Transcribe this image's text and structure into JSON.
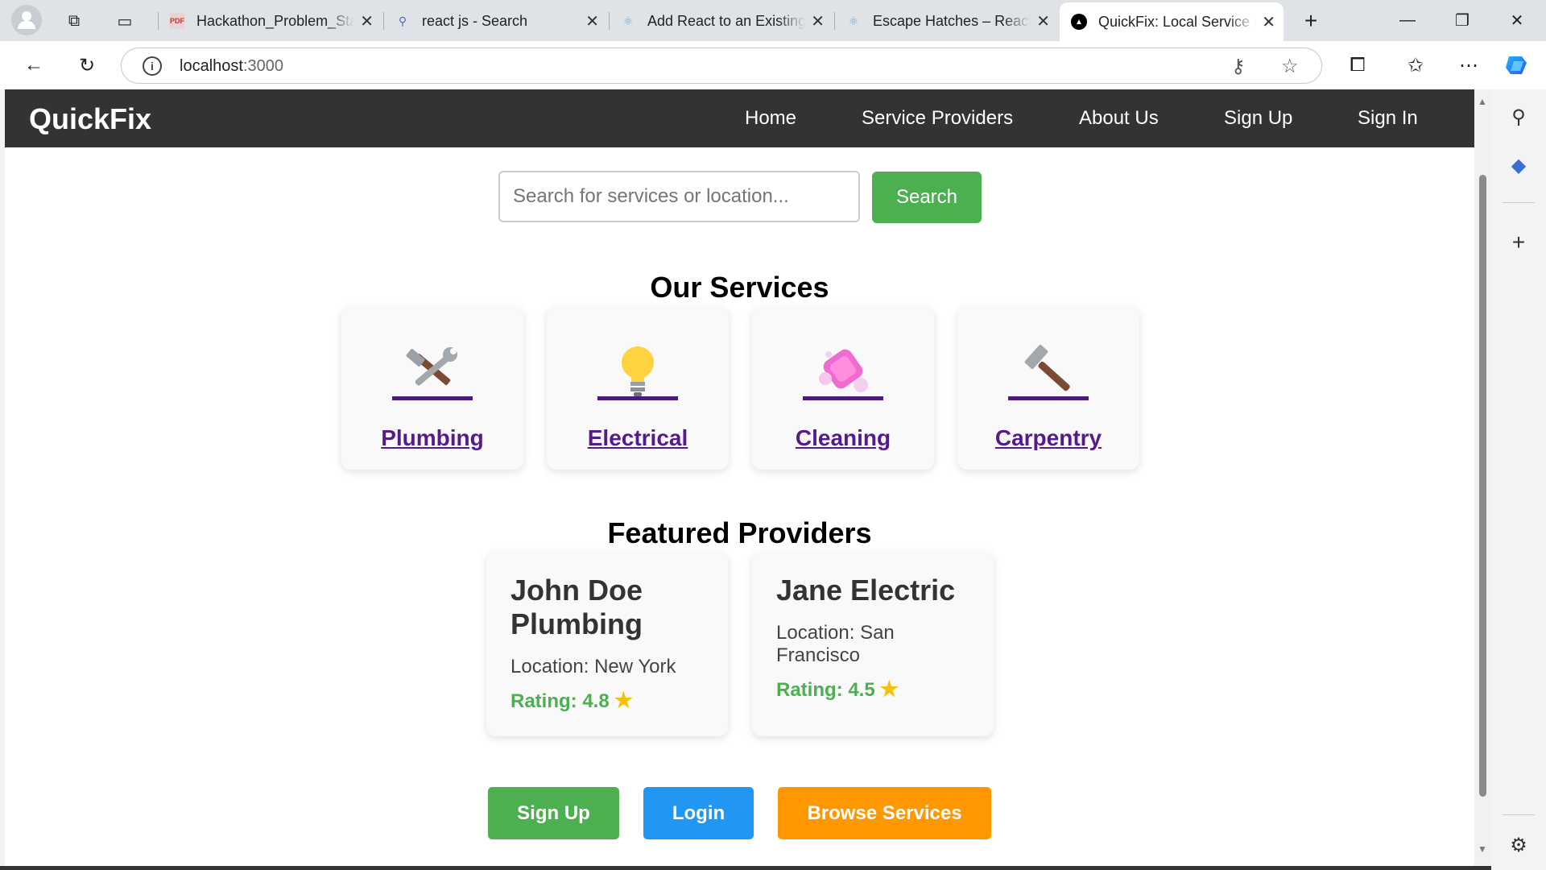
{
  "browser": {
    "tabs": [
      {
        "title": "Hackathon_Problem_Statement",
        "icon": "pdf-icon"
      },
      {
        "title": "react js - Search",
        "icon": "search-icon"
      },
      {
        "title": "Add React to an Existing Project",
        "icon": "react-icon"
      },
      {
        "title": "Escape Hatches – React",
        "icon": "react-icon"
      },
      {
        "title": "QuickFix: Local Service Finder",
        "icon": "vercel-icon",
        "active": true
      }
    ],
    "url_host": "localhost",
    "url_port": ":3000"
  },
  "app": {
    "brand": "QuickFix",
    "menu": [
      "Home",
      "Service Providers",
      "About Us",
      "Sign Up",
      "Sign In"
    ],
    "search": {
      "placeholder": "Search for services or location...",
      "button": "Search"
    },
    "services_title": "Our Services",
    "services": [
      {
        "name": "Plumbing",
        "icon": "tools-icon"
      },
      {
        "name": "Electrical",
        "icon": "lightbulb-icon"
      },
      {
        "name": "Cleaning",
        "icon": "soap-icon"
      },
      {
        "name": "Carpentry",
        "icon": "hammer-icon"
      }
    ],
    "providers_title": "Featured Providers",
    "providers": [
      {
        "name": "John Doe Plumbing",
        "location": "Location: New York",
        "rating": "Rating: 4.8"
      },
      {
        "name": "Jane Electric",
        "location": "Location: San Francisco",
        "rating": "Rating: 4.5"
      }
    ],
    "cta": {
      "signup": "Sign Up",
      "login": "Login",
      "browse": "Browse Services"
    }
  },
  "colors": {
    "navbar": "#333333",
    "green": "#4caf50",
    "blue": "#2196f3",
    "orange": "#ff9800",
    "link_purple": "#551a8b"
  }
}
